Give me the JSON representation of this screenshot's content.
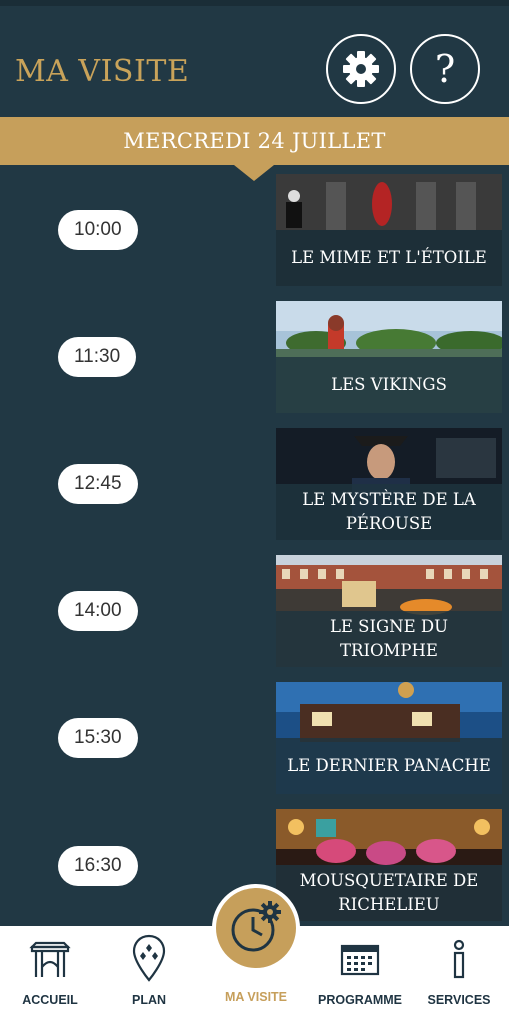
{
  "header": {
    "title": "MA VISITE",
    "settings_icon": "gear-icon",
    "help_label": "?"
  },
  "date_banner": "MERCREDI 24 JUILLET",
  "schedule": [
    {
      "time": "10:00",
      "show": "LE MIME ET L'ÉTOILE"
    },
    {
      "time": "11:30",
      "show": "LES VIKINGS"
    },
    {
      "time": "12:45",
      "show": "LE MYSTÈRE DE LA PÉROUSE"
    },
    {
      "time": "14:00",
      "show": "LE SIGNE DU TRIOMPHE"
    },
    {
      "time": "15:30",
      "show": "LE DERNIER PANACHE"
    },
    {
      "time": "16:30",
      "show": "MOUSQUETAIRE DE RICHELIEU"
    }
  ],
  "nav": {
    "home": "ACCUEIL",
    "map": "PLAN",
    "visit": "MA VISITE",
    "program": "PROGRAMME",
    "services": "SERVICES"
  },
  "colors": {
    "background": "#213844",
    "gold": "#c69f5b",
    "white": "#ffffff"
  }
}
